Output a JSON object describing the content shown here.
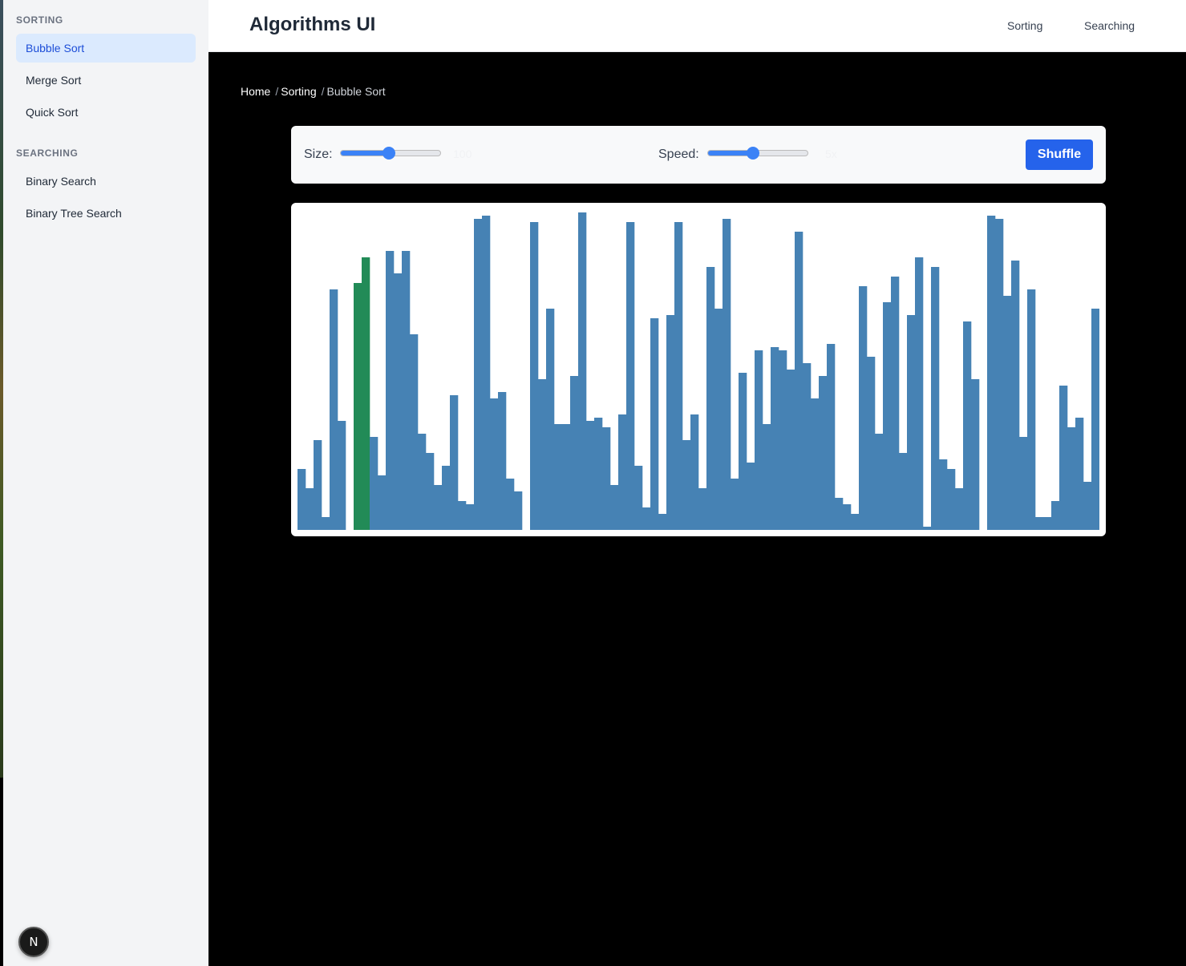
{
  "sidebar": {
    "sections": [
      {
        "title": "SORTING",
        "items": [
          {
            "label": "Bubble Sort",
            "active": true
          },
          {
            "label": "Merge Sort",
            "active": false
          },
          {
            "label": "Quick Sort",
            "active": false
          }
        ]
      },
      {
        "title": "SEARCHING",
        "items": [
          {
            "label": "Binary Search",
            "active": false
          },
          {
            "label": "Binary Tree Search",
            "active": false
          }
        ]
      }
    ],
    "badge": "N"
  },
  "header": {
    "title": "Algorithms UI",
    "nav": [
      "Sorting",
      "Searching"
    ]
  },
  "breadcrumb": [
    "Home",
    "Sorting",
    "Bubble Sort"
  ],
  "controls": {
    "size_label": "Size:",
    "size_value": "100",
    "size_fraction": 0.48,
    "speed_label": "Speed:",
    "speed_value": "5x",
    "speed_fraction": 0.45,
    "shuffle_label": "Shuffle"
  },
  "colors": {
    "bar": "#4682b4",
    "bar_active": "#228b57",
    "accent": "#2563eb"
  },
  "chart_data": {
    "type": "bar",
    "max": 100,
    "highlight": [
      7,
      8
    ],
    "values": [
      19,
      13,
      28,
      4,
      75,
      34,
      0,
      77,
      85,
      29,
      17,
      87,
      80,
      87,
      61,
      30,
      24,
      14,
      20,
      42,
      9,
      8,
      97,
      98,
      41,
      43,
      16,
      12,
      0,
      96,
      47,
      69,
      33,
      33,
      48,
      99,
      34,
      35,
      32,
      14,
      36,
      96,
      20,
      7,
      66,
      5,
      67,
      96,
      28,
      36,
      13,
      82,
      69,
      97,
      16,
      49,
      21,
      56,
      33,
      57,
      56,
      50,
      93,
      52,
      41,
      48,
      58,
      10,
      8,
      5,
      76,
      54,
      30,
      71,
      79,
      24,
      67,
      85,
      1,
      82,
      22,
      19,
      13,
      65,
      47,
      0,
      98,
      97,
      73,
      84,
      29,
      75,
      4,
      4,
      9,
      45,
      32,
      35,
      15,
      69
    ]
  }
}
